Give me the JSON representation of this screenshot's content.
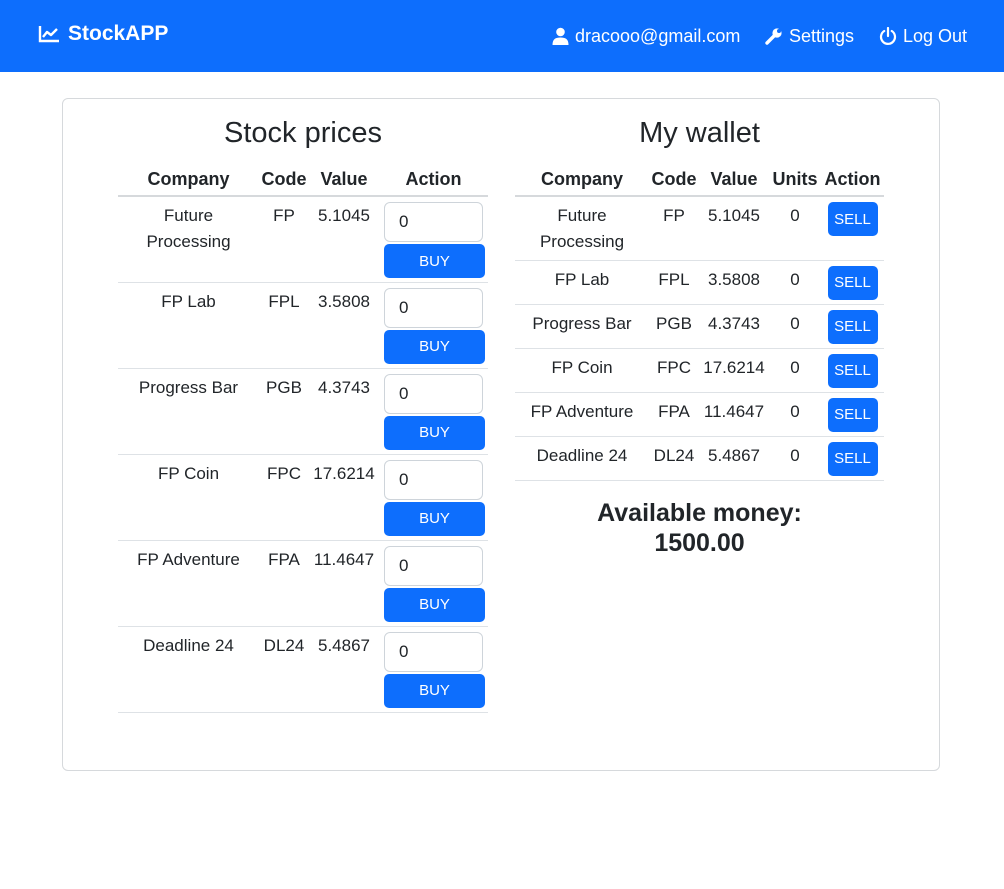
{
  "navbar": {
    "brand": "StockAPP",
    "user_email": "dracooo@gmail.com",
    "settings_label": "Settings",
    "logout_label": "Log Out"
  },
  "stock_prices": {
    "title": "Stock prices",
    "headers": [
      "Company",
      "Code",
      "Value",
      "Action"
    ],
    "buy_label": "BUY",
    "rows": [
      {
        "company": "Future Processing",
        "code": "FP",
        "value": "5.1045",
        "qty": "0"
      },
      {
        "company": "FP Lab",
        "code": "FPL",
        "value": "3.5808",
        "qty": "0"
      },
      {
        "company": "Progress Bar",
        "code": "PGB",
        "value": "4.3743",
        "qty": "0"
      },
      {
        "company": "FP Coin",
        "code": "FPC",
        "value": "17.6214",
        "qty": "0"
      },
      {
        "company": "FP Adventure",
        "code": "FPA",
        "value": "11.4647",
        "qty": "0"
      },
      {
        "company": "Deadline 24",
        "code": "DL24",
        "value": "5.4867",
        "qty": "0"
      }
    ]
  },
  "wallet": {
    "title": "My wallet",
    "headers": [
      "Company",
      "Code",
      "Value",
      "Units",
      "Action"
    ],
    "sell_label": "SELL",
    "rows": [
      {
        "company": "Future Processing",
        "code": "FP",
        "value": "5.1045",
        "units": "0"
      },
      {
        "company": "FP Lab",
        "code": "FPL",
        "value": "3.5808",
        "units": "0"
      },
      {
        "company": "Progress Bar",
        "code": "PGB",
        "value": "4.3743",
        "units": "0"
      },
      {
        "company": "FP Coin",
        "code": "FPC",
        "value": "17.6214",
        "units": "0"
      },
      {
        "company": "FP Adventure",
        "code": "FPA",
        "value": "11.4647",
        "units": "0"
      },
      {
        "company": "Deadline 24",
        "code": "DL24",
        "value": "5.4867",
        "units": "0"
      }
    ],
    "available_label": "Available money:",
    "available_amount": "1500.00"
  },
  "colors": {
    "primary": "#0d6efd",
    "border": "#dee2e6",
    "text": "#212529"
  },
  "icons": {
    "brand": "chart-line-icon",
    "user": "user-icon",
    "settings": "wrench-icon",
    "logout": "power-icon"
  }
}
